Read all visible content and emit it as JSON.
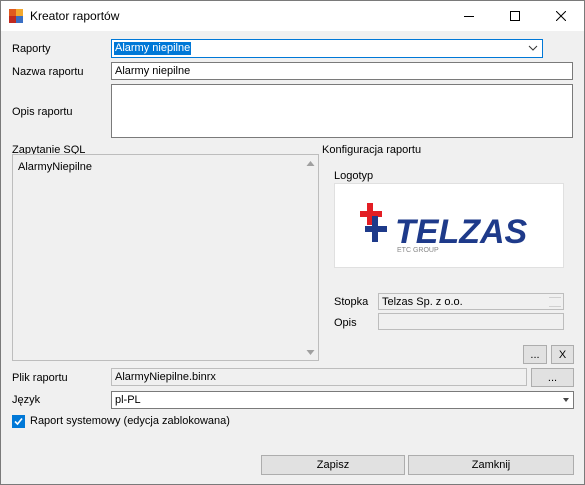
{
  "window": {
    "title": "Kreator raportów"
  },
  "form": {
    "raporty_label": "Raporty",
    "raporty_value": "Alarmy niepilne",
    "nazwa_label": "Nazwa raportu",
    "nazwa_value": "Alarmy niepilne",
    "opis_label": "Opis raportu",
    "opis_value": "",
    "sql_label": "Zapytanie SQL",
    "sql_value": "AlarmyNiepilne",
    "konfig_label": "Konfiguracja raportu",
    "logotyp_label": "Logotyp",
    "logo": {
      "name": "TELZAS",
      "tagline": "ETC GROUP",
      "color_primary": "#1e3a8a",
      "color_accent": "#e31e24"
    },
    "stopka_label": "Stopka",
    "stopka_value": "Telzas Sp. z o.o.",
    "opis_cfg_label": "Opis",
    "opis_cfg_value": "",
    "dots_label": "...",
    "x_label": "X",
    "plik_label": "Plik raportu",
    "plik_value": "AlarmyNiepilne.binrx",
    "plik_browse_label": "...",
    "jezyk_label": "Język",
    "jezyk_value": "pl-PL",
    "system_checkbox_label": "Raport systemowy (edycja zablokowana)",
    "system_checked": true
  },
  "buttons": {
    "save": "Zapisz",
    "close": "Zamknij"
  },
  "colors": {
    "accent": "#0078d7"
  }
}
